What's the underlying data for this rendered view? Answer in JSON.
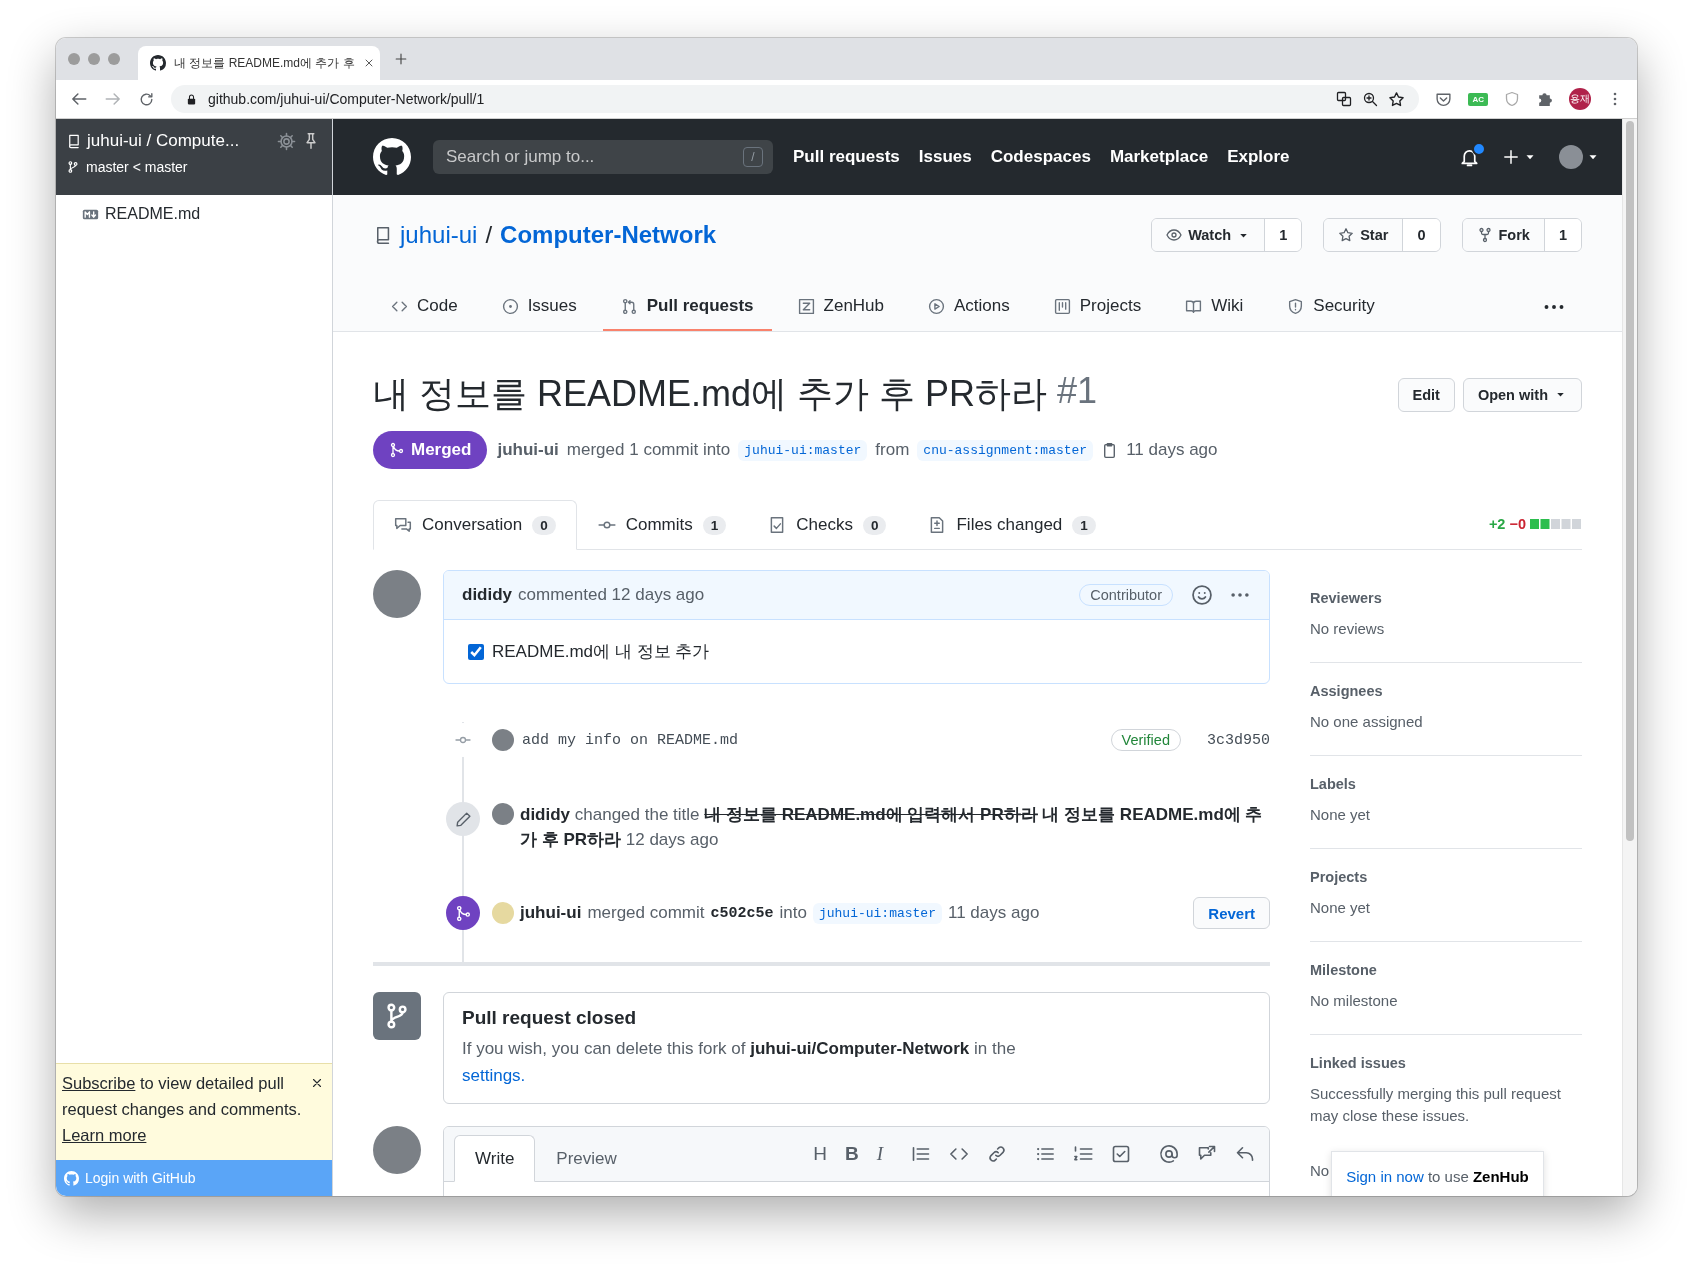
{
  "browser": {
    "tab_title": "내 정보를 README.md에 추가 후",
    "url": "github.com/juhui-ui/Computer-Network/pull/1",
    "extension_badge": "AC",
    "profile_badge": "용재"
  },
  "octotree": {
    "repo": "juhui-ui / Compute...",
    "branch": "master < master",
    "files": [
      {
        "name": "README.md"
      }
    ],
    "notice": {
      "link": "Subscribe",
      "text": "to view detailed pull request changes and comments.",
      "more_link": "Learn more"
    },
    "login": "Login with GitHub"
  },
  "header": {
    "search_placeholder": "Search or jump to...",
    "search_key": "/",
    "nav": [
      "Pull requests",
      "Issues",
      "Codespaces",
      "Marketplace",
      "Explore"
    ],
    "unread_notifications": true
  },
  "repo": {
    "owner": "juhui-ui",
    "separator": "/",
    "name": "Computer-Network",
    "actions": [
      {
        "kind": "watch",
        "label": "Watch",
        "count": "1"
      },
      {
        "kind": "star",
        "label": "Star",
        "count": "0"
      },
      {
        "kind": "fork",
        "label": "Fork",
        "count": "1"
      }
    ],
    "tabs": [
      {
        "kind": "code",
        "label": "Code",
        "selected": false
      },
      {
        "kind": "issues",
        "label": "Issues",
        "selected": false
      },
      {
        "kind": "pulls",
        "label": "Pull requests",
        "selected": true
      },
      {
        "kind": "zenhub",
        "label": "ZenHub",
        "selected": false
      },
      {
        "kind": "actions",
        "label": "Actions",
        "selected": false
      },
      {
        "kind": "projects",
        "label": "Projects",
        "selected": false
      },
      {
        "kind": "wiki",
        "label": "Wiki",
        "selected": false
      },
      {
        "kind": "security",
        "label": "Security",
        "selected": false
      }
    ]
  },
  "pull_request": {
    "title": "내 정보를 README.md에 추가 후 PR하라",
    "number": "#1",
    "buttons": [
      "Edit",
      "Open with"
    ],
    "state": "Merged",
    "author": "juhui-ui",
    "summary": "merged 1 commit into",
    "base": "juhui-ui:master",
    "from": "from",
    "head": "cnu-assignment:master",
    "time": "11 days ago",
    "tabs": [
      {
        "kind": "conversation",
        "label": "Conversation",
        "count": "0",
        "selected": true
      },
      {
        "kind": "commits",
        "label": "Commits",
        "count": "1",
        "selected": false
      },
      {
        "kind": "checks",
        "label": "Checks",
        "count": "0",
        "selected": false
      },
      {
        "kind": "files",
        "label": "Files changed",
        "count": "1",
        "selected": false
      }
    ],
    "diffstat": {
      "added": "+2",
      "removed": "−0"
    },
    "comment": {
      "author": "dididy",
      "action": "commented 12 days ago",
      "badge": "Contributor",
      "task": {
        "text": "README.md에 내 정보 추가",
        "checked": true
      }
    },
    "events": [
      {
        "kind": "commit",
        "message": "add my info on README.md",
        "badge": "Verified",
        "sha": "3c3d950"
      },
      {
        "kind": "rename",
        "author": "dididy",
        "action": "changed the title",
        "old_title": "내 정보를 README.md에 입력해서 PR하라",
        "new_title": "내 정보를 README.md에 추가 후 PR하라",
        "time": "12 days ago"
      },
      {
        "kind": "merge",
        "author": "juhui-ui",
        "action": "merged commit",
        "sha": "c502c5e",
        "into": "into",
        "branch": "juhui-ui:master",
        "time": "11 days ago",
        "button": "Revert"
      }
    ],
    "closed": {
      "title": "Pull request closed",
      "text": "If you wish, you can delete this fork of **juhui-ui/Computer-Network** in the",
      "link": "settings."
    },
    "editor": {
      "tabs": [
        {
          "label": "Write",
          "selected": true
        },
        {
          "label": "Preview",
          "selected": false
        }
      ],
      "tool_groups": [
        [
          {
            "kind": "heading",
            "glyph": "H"
          },
          {
            "kind": "bold",
            "glyph": "B"
          },
          {
            "kind": "italic",
            "glyph": "I"
          }
        ],
        [
          {
            "kind": "quote"
          },
          {
            "kind": "code"
          },
          {
            "kind": "link"
          }
        ],
        [
          {
            "kind": "bulleted-list"
          },
          {
            "kind": "numbered-list"
          },
          {
            "kind": "task-list"
          }
        ],
        [
          {
            "kind": "mention"
          },
          {
            "kind": "reference"
          },
          {
            "kind": "reply"
          }
        ]
      ]
    }
  },
  "sidebar": [
    {
      "heading": "Reviewers",
      "value": "No reviews"
    },
    {
      "heading": "Assignees",
      "value": "No one assigned"
    },
    {
      "heading": "Labels",
      "value": "None yet"
    },
    {
      "heading": "Projects",
      "value": "None yet"
    },
    {
      "heading": "Milestone",
      "value": "No milestone"
    },
    {
      "heading": "Linked issues",
      "value": "Successfully merging this pull request may close these issues.",
      "note": "No"
    }
  ],
  "zenhub_popup": {
    "link": "Sign in now",
    "text": "to use",
    "brand": "ZenHub"
  }
}
